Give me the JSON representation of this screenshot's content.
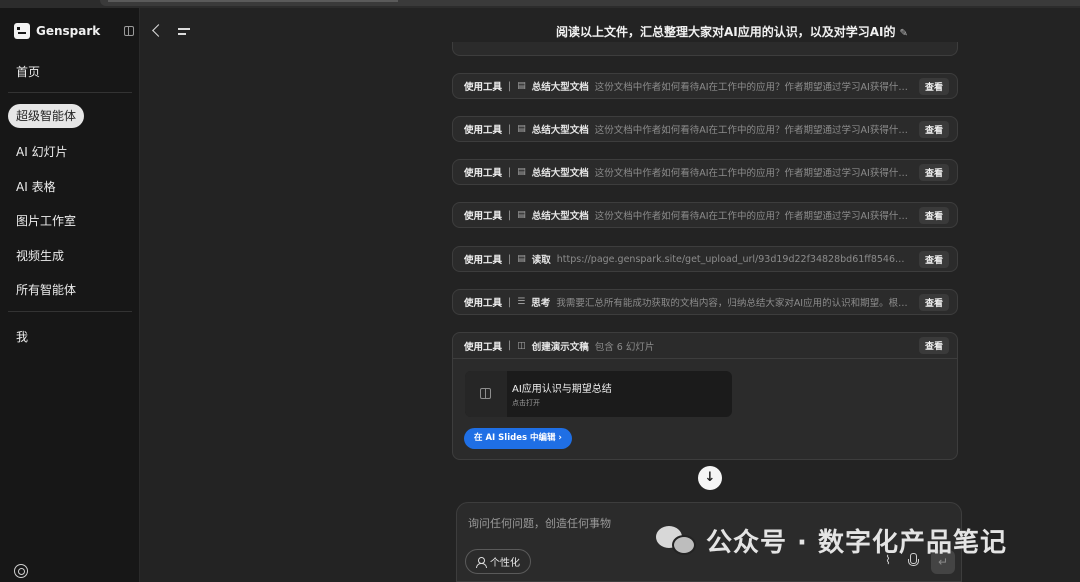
{
  "sidebar": {
    "brand": "Genspark",
    "items": {
      "home": "首页",
      "super_agent": "超级智能体",
      "ai_slides": "AI 幻灯片",
      "ai_sheets": "AI 表格",
      "image_studio": "图片工作室",
      "video_gen": "视频生成",
      "all_agents": "所有智能体",
      "me": "我"
    }
  },
  "header": {
    "title": "阅读以上文件，汇总整理大家对AI应用的认识，以及对学习AI的",
    "edit_icon": "✎"
  },
  "tool_cards": [
    {
      "tag": "使用工具",
      "sep": "|",
      "icon": "▤",
      "action": "总结大型文档",
      "desc": "这份文档中作者如何看待AI在工作中的应用？作者期望通过学习AI获得什么？",
      "view": "查看"
    },
    {
      "tag": "使用工具",
      "sep": "|",
      "icon": "▤",
      "action": "总结大型文档",
      "desc": "这份文档中作者如何看待AI在工作中的应用？作者期望通过学习AI获得什么？",
      "view": "查看"
    },
    {
      "tag": "使用工具",
      "sep": "|",
      "icon": "▤",
      "action": "总结大型文档",
      "desc": "这份文档中作者如何看待AI在工作中的应用？作者期望通过学习AI获得什么？",
      "view": "查看"
    },
    {
      "tag": "使用工具",
      "sep": "|",
      "icon": "▤",
      "action": "总结大型文档",
      "desc": "这份文档中作者如何看待AI在工作中的应用？作者期望通过学习AI获得什么？",
      "view": "查看"
    },
    {
      "tag": "使用工具",
      "sep": "|",
      "icon": "▤",
      "action": "读取",
      "desc": "https://page.genspark.site/get_upload_url/93d19d22f34828bd61ff85462ca0bd4f...",
      "view": "查看"
    },
    {
      "tag": "使用工具",
      "sep": "|",
      "icon": "☰",
      "action": "思考",
      "desc": "我需要汇总所有能成功获取的文档内容，归纳总结大家对AI应用的认识和期望。根据...",
      "view": "查看"
    }
  ],
  "slides_card": {
    "tag": "使用工具",
    "sep": "|",
    "icon": "◫",
    "action": "创建演示文稿",
    "desc": "包含 6 幻灯片",
    "view": "查看",
    "slide_title": "AI应用认识与期望总结",
    "slide_sub": "点击打开",
    "edit_button": "在 AI Slides 中编辑  ›"
  },
  "scroll_down": "↓",
  "input": {
    "placeholder": "询问任何问题，创造任何事物",
    "personalize": "个性化",
    "clip_icon": "⌇",
    "send_icon": "↵"
  },
  "watermark": {
    "text": "公众号 · 数字化产品笔记"
  }
}
